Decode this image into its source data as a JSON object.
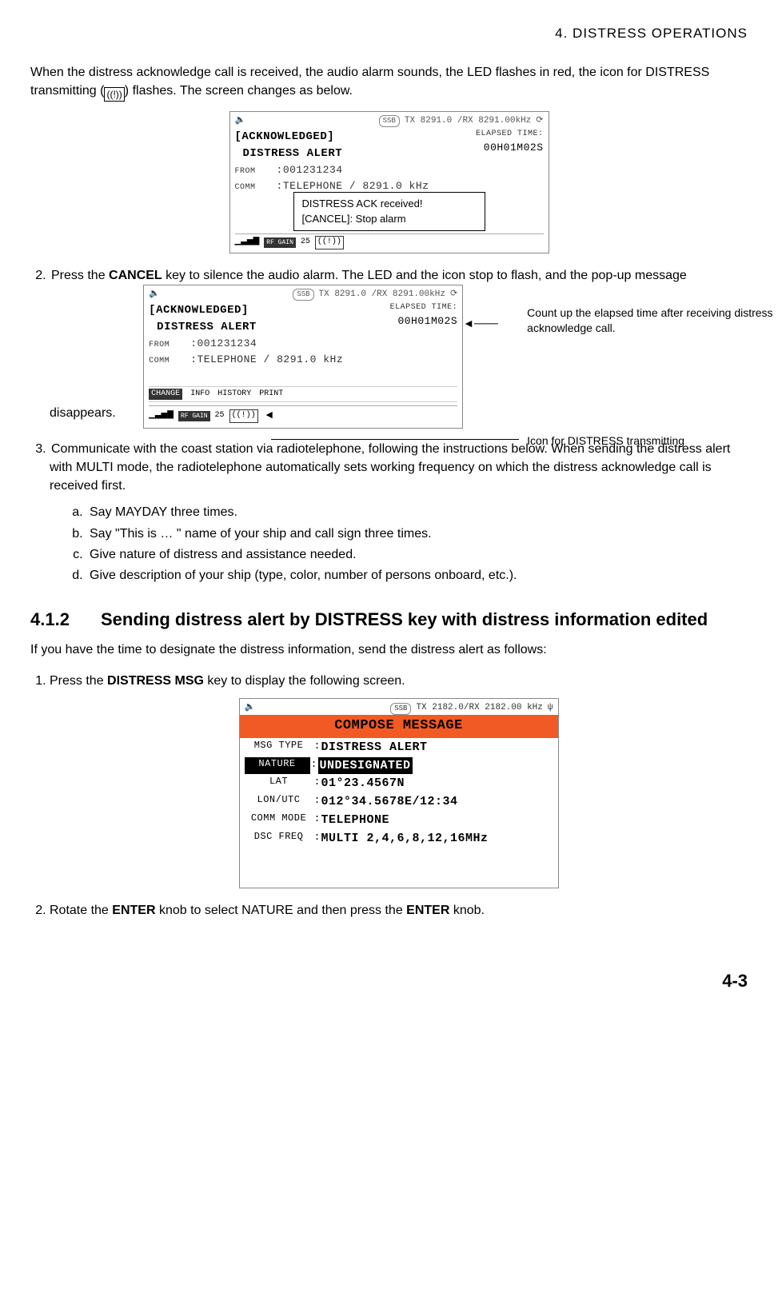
{
  "header": "4.  DISTRESS  OPERATIONS",
  "intro": {
    "p1a": "When the distress acknowledge call is received, the audio alarm sounds, the LED flashes in red, the icon for DISTRESS transmitting (",
    "p1b": ") flashes. The screen changes as below.",
    "icon_label": "((!))"
  },
  "fig1": {
    "ssb": "SSB",
    "freq": "TX 8291.0 /RX 8291.00kHz",
    "status": "[ACKNOWLEDGED]",
    "title": "DISTRESS ALERT",
    "elapsed_label": "ELAPSED TIME:",
    "elapsed_value": "00H01M02S",
    "from_label": "FROM",
    "from_value": ":001231234",
    "comm_label": "COMM",
    "comm_value": ":TELEPHONE / 8291.0 kHz",
    "rf_gain_label": "RF GAIN",
    "rf_gain_value": "25",
    "tx_icon": "((!))",
    "popup_line1": "DISTRESS ACK received!",
    "popup_line2": "[CANCEL]: Stop alarm"
  },
  "step2": {
    "label": "2.",
    "text_a": "Press the ",
    "key": "CANCEL",
    "text_b": " key to silence the audio alarm. The LED and the icon stop to flash, and the pop-up message disappears."
  },
  "fig2": {
    "ssb": "SSB",
    "freq": "TX 8291.0 /RX 8291.00kHz",
    "status": "[ACKNOWLEDGED]",
    "title": "DISTRESS ALERT",
    "elapsed_label": "ELAPSED TIME:",
    "elapsed_value": "00H01M02S",
    "from_label": "FROM",
    "from_value": ":001231234",
    "comm_label": "COMM",
    "comm_value": ":TELEPHONE / 8291.0 kHz",
    "tab_change": "CHANGE",
    "tab_info": "INFO",
    "tab_history": "HISTORY",
    "tab_print": "PRINT",
    "rf_gain_label": "RF GAIN",
    "rf_gain_value": "25",
    "tx_icon": "((!))",
    "callout1": "Count up the elapsed time after receiving distress acknowledge call.",
    "callout2": "Icon for DISTRESS transmitting"
  },
  "step3": {
    "label": "3.",
    "text": "Communicate with the coast station via radiotelephone, following the instructions below. When sending the distress alert with MULTI mode, the radiotelephone automatically sets working frequency on which the distress acknowledge call is received first.",
    "a": "Say MAYDAY three times.",
    "b": "Say \"This is … \" name of your ship and call sign three times.",
    "c": "Give nature of distress and assistance needed.",
    "d": "Give description of your ship (type, color, number of persons onboard, etc.)."
  },
  "section": {
    "num": "4.1.2",
    "title": "Sending distress alert by DISTRESS key with distress information edited",
    "intro": "If you have the time to designate the distress information, send the distress alert as follows:"
  },
  "s412_step1": {
    "label": "1.",
    "a": "Press the ",
    "key": "DISTRESS MSG",
    "b": " key to display the following screen."
  },
  "fig3": {
    "ssb": "SSB",
    "freq": "TX 2182.0/RX 2182.00 kHz",
    "title": "COMPOSE MESSAGE",
    "rows": {
      "msg_type_label": "MSG TYPE",
      "msg_type_value": "DISTRESS ALERT",
      "nature_label": "NATURE",
      "nature_value": "UNDESIGNATED",
      "lat_label": "LAT",
      "lat_value": " 01°23.4567N",
      "lon_label": "LON/UTC",
      "lon_value": "012°34.5678E/12:34",
      "comm_label": "COMM MODE",
      "comm_value": "TELEPHONE",
      "dsc_label": "DSC FREQ",
      "dsc_value": "MULTI 2,4,6,8,12,16MHz"
    }
  },
  "s412_step2": {
    "label": "2.",
    "a": "Rotate the ",
    "key1": "ENTER",
    "b": " knob to select NATURE and then press the ",
    "key2": "ENTER",
    "c": " knob."
  },
  "page_num": "4-3"
}
